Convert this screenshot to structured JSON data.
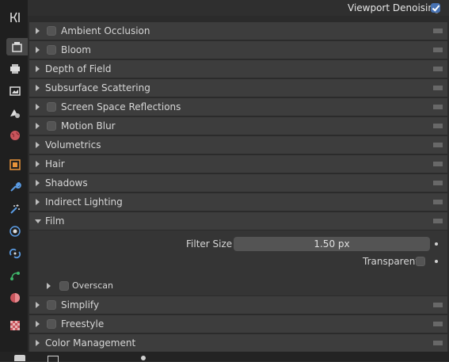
{
  "top": {
    "viewport_denoising_label": "Viewport Denoising",
    "viewport_denoising_checked": true
  },
  "panels": [
    {
      "label": "Ambient Occlusion",
      "checkbox": true,
      "checked": false
    },
    {
      "label": "Bloom",
      "checkbox": true,
      "checked": false
    },
    {
      "label": "Depth of Field",
      "checkbox": false
    },
    {
      "label": "Subsurface Scattering",
      "checkbox": false
    },
    {
      "label": "Screen Space Reflections",
      "checkbox": true,
      "checked": false
    },
    {
      "label": "Motion Blur",
      "checkbox": true,
      "checked": false
    },
    {
      "label": "Volumetrics",
      "checkbox": false
    },
    {
      "label": "Hair",
      "checkbox": false
    },
    {
      "label": "Shadows",
      "checkbox": false
    },
    {
      "label": "Indirect Lighting",
      "checkbox": false
    },
    {
      "label": "Film",
      "checkbox": false,
      "expanded": true
    }
  ],
  "film": {
    "filter_size_label": "Filter Size",
    "filter_size_value": "1.50 px",
    "transparent_label": "Transparent",
    "transparent_checked": false,
    "overscan_label": "Overscan",
    "overscan_checked": false
  },
  "panels_after": [
    {
      "label": "Simplify",
      "checkbox": true,
      "checked": false
    },
    {
      "label": "Freestyle",
      "checkbox": true,
      "checked": false
    },
    {
      "label": "Color Management",
      "checkbox": false
    }
  ],
  "tabs": [
    "tool-icon",
    "render-icon",
    "output-icon",
    "view-layer-icon",
    "scene-icon",
    "world-icon",
    "object-icon",
    "modifier-icon",
    "particles-icon",
    "physics-icon",
    "constraints-icon",
    "object-data-icon",
    "material-icon",
    "texture-icon"
  ]
}
